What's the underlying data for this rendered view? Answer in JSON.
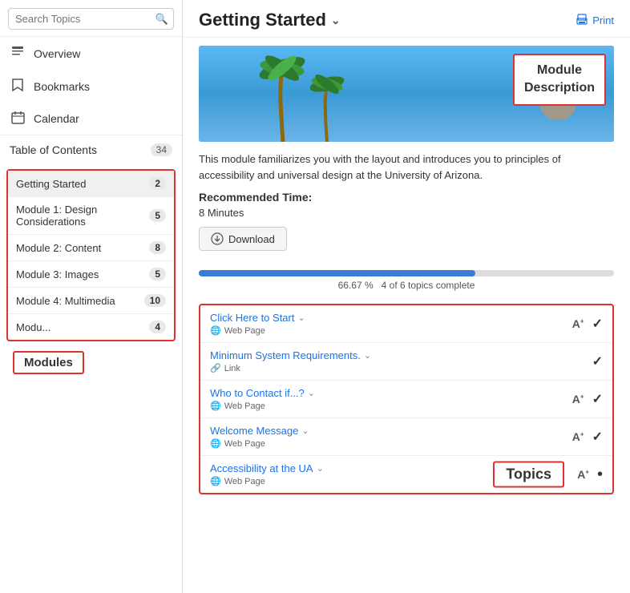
{
  "sidebar": {
    "search_placeholder": "Search Topics",
    "nav_items": [
      {
        "id": "overview",
        "label": "Overview",
        "icon": "📋"
      },
      {
        "id": "bookmarks",
        "label": "Bookmarks",
        "icon": "🔖"
      },
      {
        "id": "calendar",
        "label": "Calendar",
        "icon": "📅"
      }
    ],
    "toc": {
      "label": "Table of Contents",
      "count": "34"
    },
    "modules": [
      {
        "id": "getting-started",
        "label": "Getting Started",
        "count": "2",
        "active": true
      },
      {
        "id": "module1",
        "label": "Module 1: Design Considerations",
        "count": "5",
        "active": false
      },
      {
        "id": "module2",
        "label": "Module 2: Content",
        "count": "8",
        "active": false
      },
      {
        "id": "module3",
        "label": "Module 3: Images",
        "count": "5",
        "active": false
      },
      {
        "id": "module4",
        "label": "Module 4: Multimedia",
        "count": "10",
        "bold": true,
        "active": false
      },
      {
        "id": "module5",
        "label": "Modu...",
        "count": "4",
        "active": false
      }
    ],
    "modules_label": "Modules"
  },
  "main": {
    "title": "Getting Started",
    "print_label": "Print",
    "description": "This module familiarizes you with the layout and introduces you to principles of accessibility and universal design at the University of Arizona.",
    "module_description_label": "Module\nDescription",
    "recommended_time_label": "Recommended Time:",
    "time_value": "8 Minutes",
    "download_label": "Download",
    "progress": {
      "percent": 66.67,
      "percent_label": "66.67 %",
      "topics_done": "4 of 6 topics complete"
    },
    "topics_label": "Topics",
    "topics": [
      {
        "id": "click-here",
        "title": "Click Here to Start",
        "type": "Web Page",
        "type_icon": "globe",
        "has_font_resize": true,
        "status": "check"
      },
      {
        "id": "min-sys",
        "title": "Minimum System Requirements.",
        "type": "Link",
        "type_icon": "link",
        "has_font_resize": false,
        "status": "check"
      },
      {
        "id": "who-contact",
        "title": "Who to Contact if...?",
        "type": "Web Page",
        "type_icon": "globe",
        "has_font_resize": true,
        "status": "check"
      },
      {
        "id": "welcome",
        "title": "Welcome Message",
        "type": "Web Page",
        "type_icon": "globe",
        "has_font_resize": true,
        "status": "check"
      },
      {
        "id": "accessibility",
        "title": "Accessibility at the UA",
        "type": "Web Page",
        "type_icon": "globe",
        "has_font_resize": true,
        "status": "dot"
      }
    ]
  }
}
